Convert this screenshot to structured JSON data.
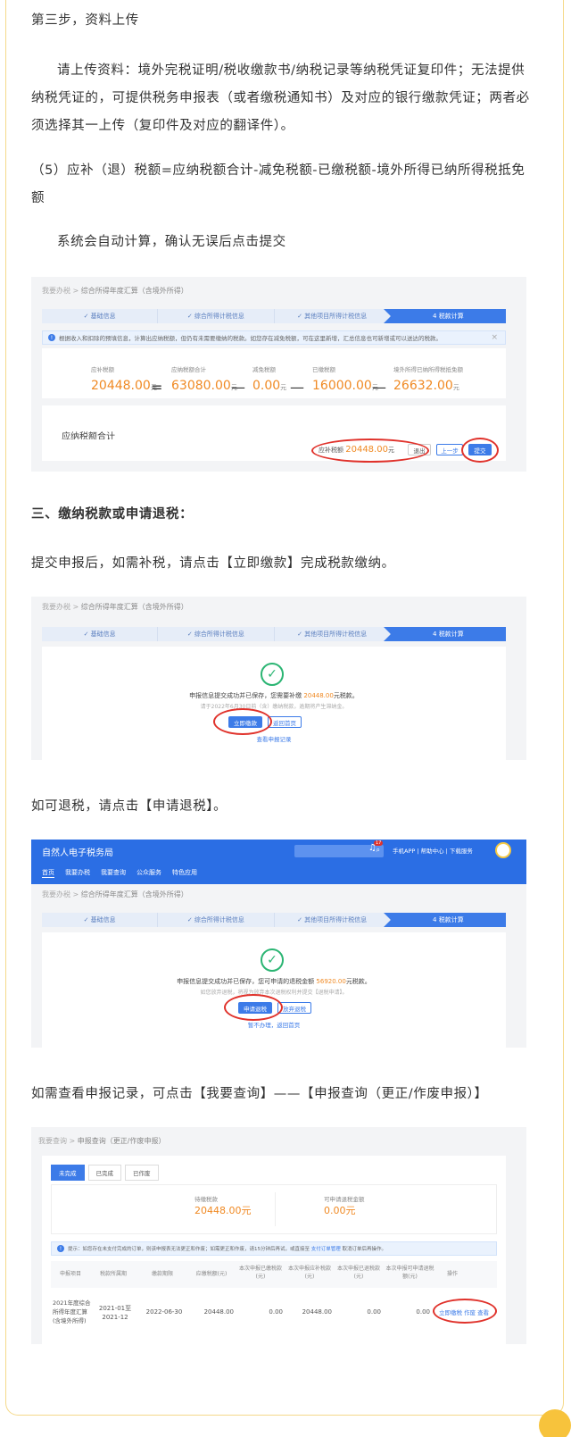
{
  "text": {
    "step3_title": "第三步，资料上传",
    "upload_para": "请上传资料：境外完税证明/税收缴款书/纳税记录等纳税凭证复印件；无法提供纳税凭证的，可提供税务申报表（或者缴税通知书）及对应的银行缴款凭证；两者必须选择其一上传（复印件及对应的翻译件）。",
    "formula_para": "（5）应补（退）税额=应纳税额合计-减免税额-已缴税额-境外所得已纳所得税抵免额",
    "auto_calc": "系统会自动计算，确认无误后点击提交",
    "section3": "三、缴纳税款或申请退税：",
    "pay_para": "提交申报后，如需补税，请点击【立即缴款】完成税款缴纳。",
    "refund_para": "如可退税，请点击【申请退税】。",
    "query_para": "如需查看申报记录，可点击【我要查询】——【申报查询（更正/作废申报）】"
  },
  "shot1": {
    "crumb_home": "我要办税",
    "crumb_sep": ">",
    "crumb_cur": "综合所得年度汇算（含境外所得）",
    "steps": [
      "✓ 基础信息",
      "✓ 综合所得计税信息",
      "✓ 其他项目所得计税信息",
      "4  税款计算"
    ],
    "notice": "根据收入和扣除的预填信息，计算出应纳税额，但仍有未需要缴纳的税款。如您存在减免税额，可在这里新增，汇总信息也可新增或可以送达的税款。",
    "close": "×",
    "labels": [
      "应补税额",
      "应纳税额合计",
      "减免税额",
      "已缴税额",
      "境外所得已纳所得税抵免额"
    ],
    "values": [
      "20448.00",
      "63080.00",
      "0.00",
      "16000.00",
      "26632.00"
    ],
    "unit": "元",
    "eq": "=",
    "minus": "—",
    "section_label": "应纳税额合计",
    "bottom_label": "应补税额",
    "bottom_value": "20448.00",
    "btn_exit": "退出",
    "btn_prev": "上一步",
    "btn_submit": "提交"
  },
  "shot2": {
    "crumb_home": "我要办税",
    "crumb_sep": ">",
    "crumb_cur": "综合所得年度汇算（含境外所得）",
    "steps": [
      "✓ 基础信息",
      "✓ 综合所得计税信息",
      "✓ 其他项目所得计税信息",
      "4  税款计算"
    ],
    "msg_pre": "申报信息提交成功并已保存，您需要补缴 ",
    "msg_amount": "20448.00",
    "msg_post": "元税款。",
    "sub": "请于2022年6月30日前（含）缴纳税款，逾期将产生滞纳金。",
    "btn_pay": "立即缴款",
    "btn_home": "返回首页",
    "link": "查看申报记录"
  },
  "shot3": {
    "site_title": "自然人电子税务局",
    "nav": [
      "首页",
      "我要办税",
      "我要查询",
      "公众服务",
      "特色应用"
    ],
    "top_right": "手机APP  |  帮助中心  |  下载服务",
    "badge": "17",
    "crumb_home": "我要办税",
    "crumb_sep": ">",
    "crumb_cur": "综合所得年度汇算（含境外所得）",
    "steps": [
      "✓ 基础信息",
      "✓ 综合所得计税信息",
      "✓ 其他项目所得计税信息",
      "4  税款计算"
    ],
    "msg_pre": "申报信息提交成功并已保存，您可申请的退税金额 ",
    "msg_amount": "56920.00",
    "msg_post": "元税款。",
    "sub": "如您放弃退税，将视为放弃本次退税权利并提交【退税申请】。",
    "btn_refund": "申请退税",
    "btn_give_up": "放弃退税",
    "link": "暂不办理，返回首页"
  },
  "shot4": {
    "crumb_home": "我要查询",
    "crumb_sep": ">",
    "crumb_cur": "申报查询（更正/作废申报）",
    "tabs": [
      "未完成",
      "已完成",
      "已作废"
    ],
    "summary_label1": "待缴税款",
    "summary_value1": "20448.00",
    "summary_label2": "可申请退税金额",
    "summary_value2": "0.00",
    "unit": "元",
    "notice_pre": "提示：如您存在未支付完成的订单，则该申报表无法更正和作废；如需更正和作废，请15分钟后再试，或直接至 ",
    "notice_link": "支付订单管理",
    "notice_post": " 取消订单后再操作。",
    "headers": [
      "申报项目",
      "税款所属期",
      "缴款期限",
      "应缴税额(元)",
      "本次申报已缴税款(元)",
      "本次申报应补税款(元)",
      "本次申报已退税款(元)",
      "本次申报可申请退税额(元)",
      "操作"
    ],
    "row": {
      "project": "2021年度综合所得年度汇算(含境外所得)",
      "period": "2021-01至2021-12",
      "deadline": "2022-06-30",
      "due": "20448.00",
      "paid": "0.00",
      "supplement": "20448.00",
      "refunded": "0.00",
      "refundable": "0.00",
      "actions": [
        "立即缴税",
        "作废",
        "查看"
      ]
    }
  }
}
